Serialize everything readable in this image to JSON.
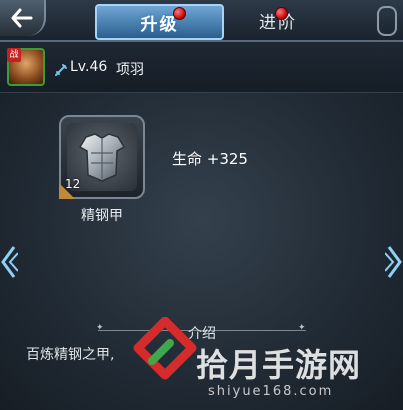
{
  "tabs": {
    "upgrade_label": "升级",
    "advance_label": "进阶"
  },
  "hero": {
    "badge": "战",
    "level": "Lv.46",
    "name": "项羽"
  },
  "item": {
    "count": "12",
    "name": "精钢甲"
  },
  "stat": {
    "text": "生命 +325"
  },
  "intro": {
    "title": "介绍",
    "text": "百炼精钢之甲,"
  },
  "watermark": {
    "text": "拾月手游网",
    "url": "shiyue168.com"
  },
  "colors": {
    "accent_blue": "#6fa7d6",
    "notify_red": "#c00000",
    "avatar_border": "#3d9a3d"
  }
}
